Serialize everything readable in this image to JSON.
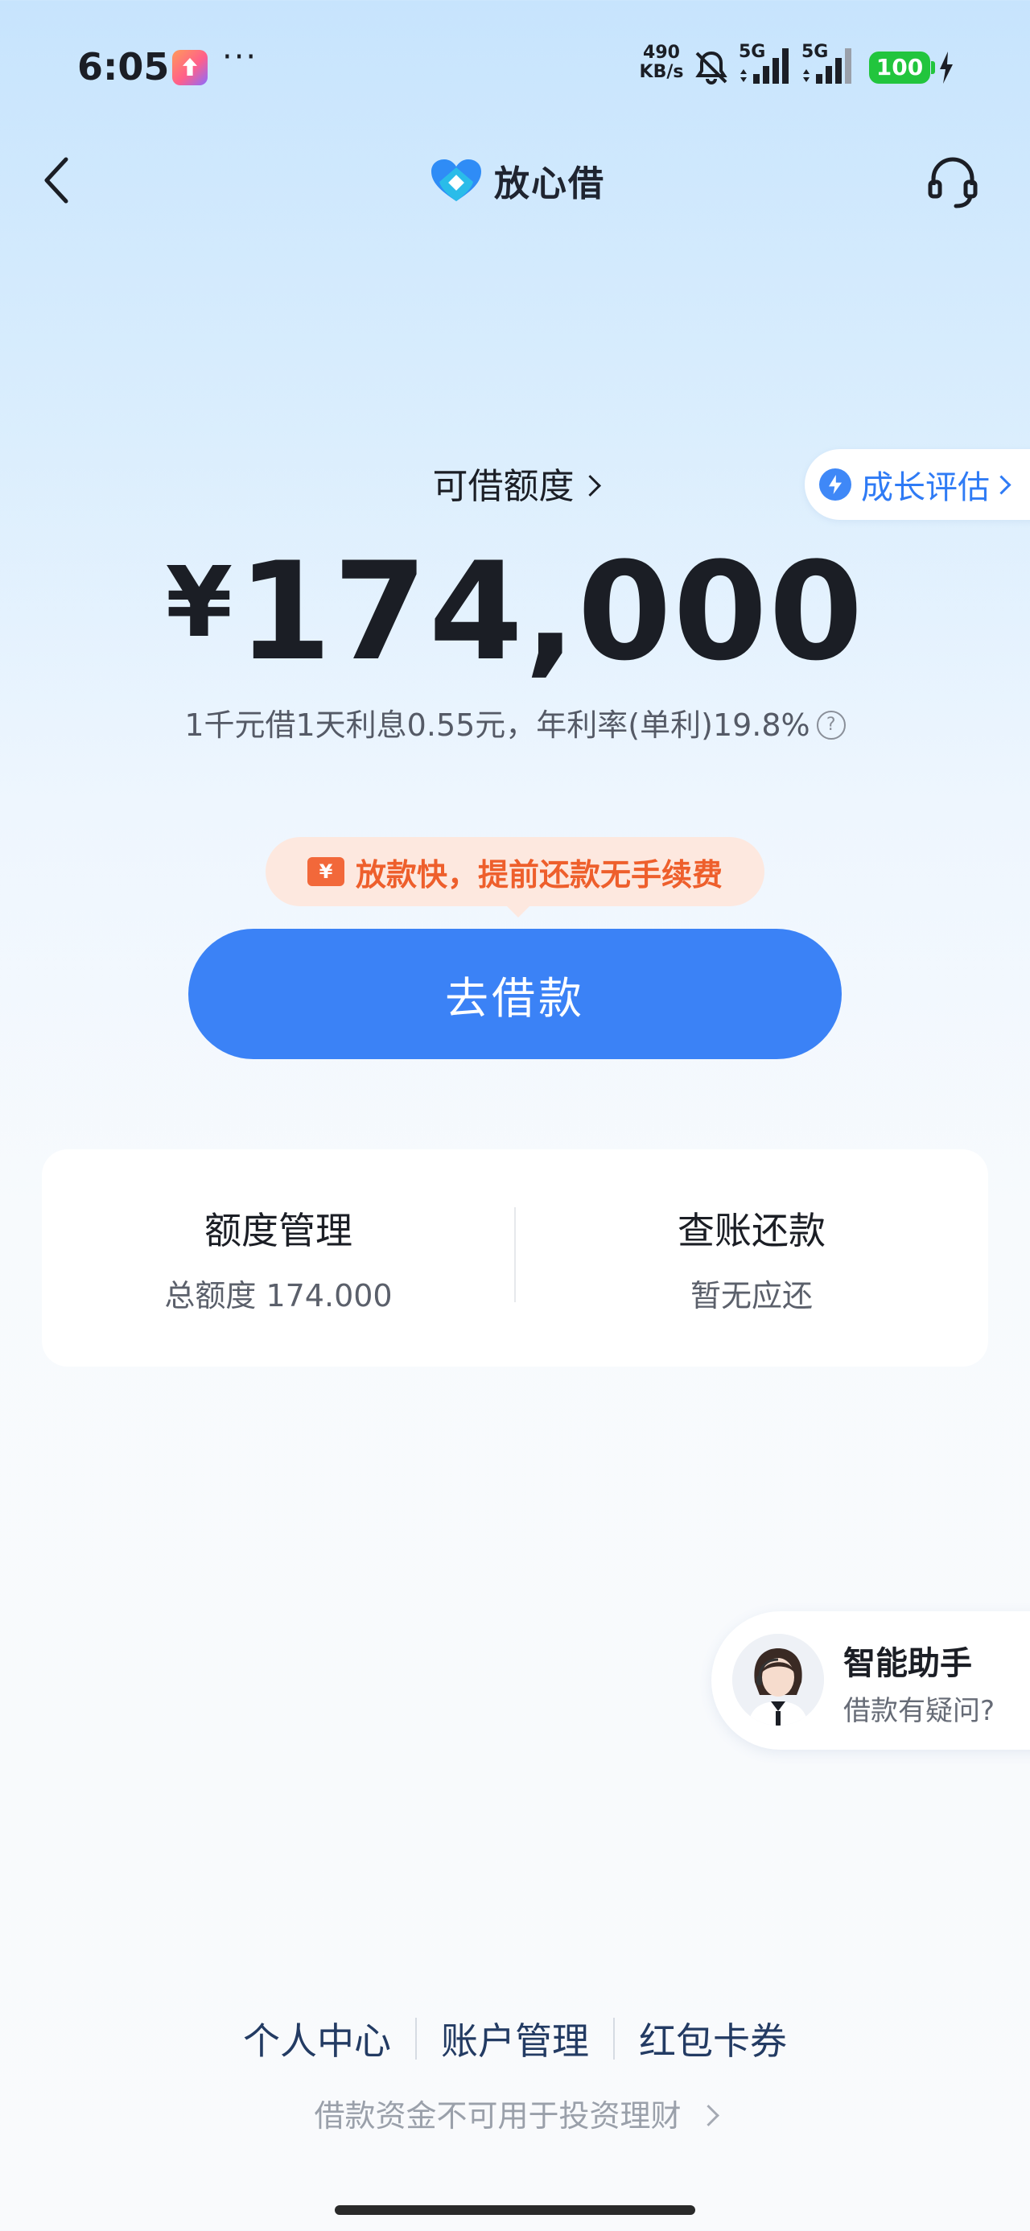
{
  "status_bar": {
    "time": "6:05",
    "more": "···",
    "net_speed_value": "490",
    "net_speed_unit": "KB/s",
    "sim1_label": "5G",
    "sim2_label": "5G",
    "battery": "100"
  },
  "header": {
    "brand": "放心借"
  },
  "credit": {
    "title": "可借额度",
    "currency": "¥",
    "amount": "174,000",
    "rate_text": "1千元借1天利息0.55元，年利率(单利)19.8%",
    "help": "?",
    "growth_label": "成长评估"
  },
  "promo": {
    "ticket_symbol": "¥",
    "text": "放款快，提前还款无手续费"
  },
  "borrow_button": "去借款",
  "cards": {
    "left_title": "额度管理",
    "left_sub": "总额度 174.000",
    "right_title": "查账还款",
    "right_sub": "暂无应还"
  },
  "assistant": {
    "title": "智能助手",
    "subtitle": "借款有疑问?"
  },
  "bottom_nav": {
    "items": [
      "个人中心",
      "账户管理",
      "红包卡券"
    ]
  },
  "disclaimer": "借款资金不可用于投资理财",
  "colors": {
    "primary": "#3b82f6",
    "promo_orange": "#ee5f2c",
    "battery_green": "#22c53d"
  }
}
